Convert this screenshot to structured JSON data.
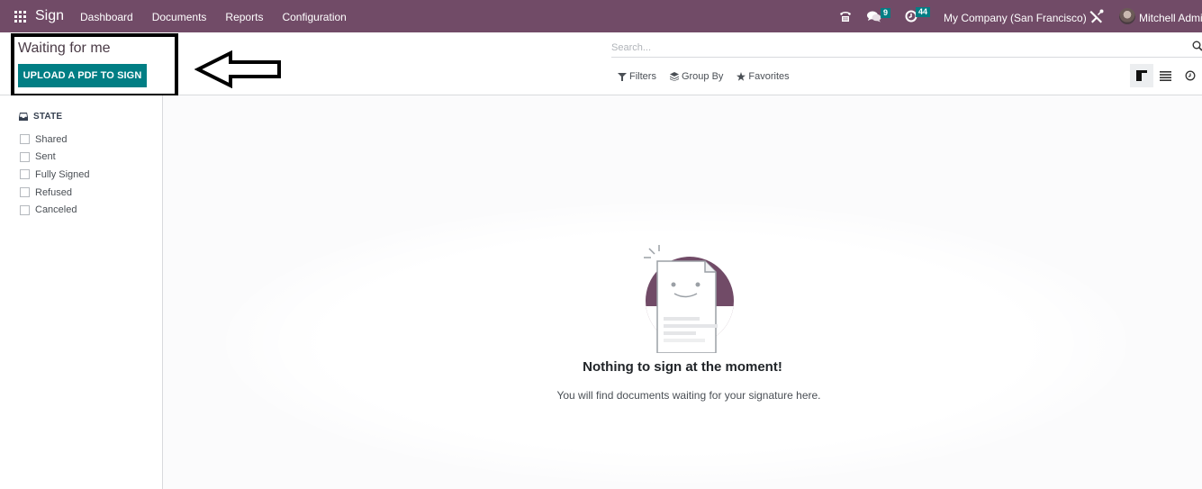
{
  "navbar": {
    "app_name": "Sign",
    "menu": [
      "Dashboard",
      "Documents",
      "Reports",
      "Configuration"
    ],
    "messages_count": "9",
    "activities_count": "44",
    "company": "My Company (San Francisco)",
    "user_name": "Mitchell Admin",
    "icons": {
      "apps": "apps-grid-icon",
      "phone": "phone-icon",
      "messages": "chat-icon",
      "activities": "clock-icon",
      "debug": "tools-icon"
    },
    "colors": {
      "brand": "#714b67",
      "badge": "#017e84"
    }
  },
  "control_panel": {
    "title": "Waiting for me",
    "upload_button": "UPLOAD A PDF TO SIGN",
    "search_placeholder": "Search...",
    "filters_label": "Filters",
    "group_by_label": "Group By",
    "favorites_label": "Favorites",
    "views": [
      "kanban",
      "list",
      "activity"
    ],
    "active_view": "kanban"
  },
  "sidebar": {
    "section_title": "STATE",
    "states": [
      {
        "label": "Shared",
        "checked": false
      },
      {
        "label": "Sent",
        "checked": false
      },
      {
        "label": "Fully Signed",
        "checked": false
      },
      {
        "label": "Refused",
        "checked": false
      },
      {
        "label": "Canceled",
        "checked": false
      }
    ]
  },
  "empty_state": {
    "title": "Nothing to sign at the moment!",
    "subtitle": "You will find documents waiting for your signature here."
  },
  "annotation": {
    "type": "arrow-pointing-left",
    "highlight": "title-and-upload-button"
  }
}
